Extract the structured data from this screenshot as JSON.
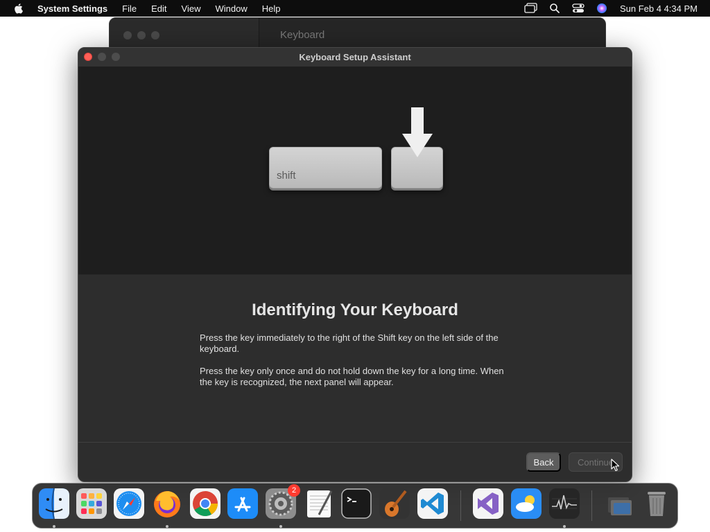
{
  "menubar": {
    "app_name": "System Settings",
    "menus": [
      "File",
      "Edit",
      "View",
      "Window",
      "Help"
    ],
    "clock": "Sun Feb 4  4:34 PM"
  },
  "background_window": {
    "title": "Keyboard"
  },
  "dialog": {
    "title": "Keyboard Setup Assistant",
    "illustration": {
      "shift_key_label": "shift"
    },
    "heading": "Identifying Your Keyboard",
    "paragraph1": "Press the key immediately to the right of the Shift key on the left side of the keyboard.",
    "paragraph2": "Press the key only once and do not hold down the key for a long time. When the key is recognized, the next panel will appear.",
    "buttons": {
      "back": "Back",
      "continue": "Continue"
    }
  },
  "dock": {
    "settings_badge": "2",
    "items": [
      "finder-icon",
      "launchpad-icon",
      "safari-icon",
      "firefox-icon",
      "chrome-icon",
      "app-store-icon",
      "system-settings-icon",
      "textedit-icon",
      "terminal-icon",
      "garageband-icon",
      "vscode-icon",
      "visual-studio-icon",
      "weather-icon",
      "activity-monitor-icon",
      "downloads-stack-icon",
      "trash-icon"
    ]
  },
  "colors": {
    "close_light": "#ff5f57",
    "dialog_bg": "#2d2d2d",
    "illustration_bg": "#1e1e1e"
  }
}
